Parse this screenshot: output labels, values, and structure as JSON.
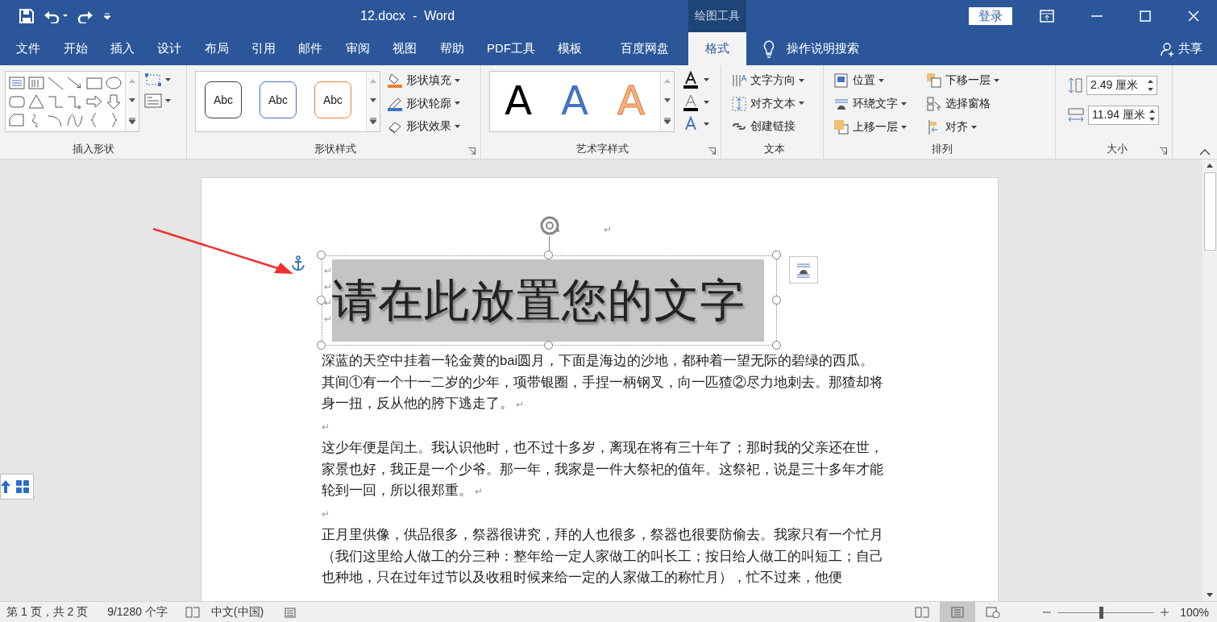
{
  "title_bar": {
    "title": "12.docx  -  Word",
    "contextual_label": "绘图工具",
    "login": "登录"
  },
  "tabs": [
    {
      "label": "文件",
      "kind": "main",
      "selected": false
    },
    {
      "label": "开始",
      "kind": "main",
      "selected": false
    },
    {
      "label": "插入",
      "kind": "main",
      "selected": false
    },
    {
      "label": "设计",
      "kind": "main",
      "selected": false
    },
    {
      "label": "布局",
      "kind": "main",
      "selected": false
    },
    {
      "label": "引用",
      "kind": "main",
      "selected": false
    },
    {
      "label": "邮件",
      "kind": "main",
      "selected": false
    },
    {
      "label": "审阅",
      "kind": "main",
      "selected": false
    },
    {
      "label": "视图",
      "kind": "main",
      "selected": false
    },
    {
      "label": "帮助",
      "kind": "main",
      "selected": false
    },
    {
      "label": "PDF工具",
      "kind": "main",
      "selected": false
    },
    {
      "label": "模板",
      "kind": "main",
      "selected": false
    },
    {
      "label": "百度网盘",
      "kind": "addin",
      "selected": false
    },
    {
      "label": "格式",
      "kind": "contextual",
      "selected": true
    }
  ],
  "tell_me": "操作说明搜索",
  "share": "共享",
  "ribbon": {
    "insert_shapes": {
      "label": "插入形状"
    },
    "shape_styles": {
      "label": "形状样式",
      "presets": [
        {
          "text": "Abc",
          "color": "#404040"
        },
        {
          "text": "Abc",
          "color": "#4472c4"
        },
        {
          "text": "Abc",
          "color": "#ed7d31"
        }
      ],
      "commands": [
        "形状填充",
        "形状轮廓",
        "形状效果"
      ]
    },
    "wordart_styles": {
      "label": "艺术字样式",
      "presets": [
        {
          "text": "A",
          "color": "#000000"
        },
        {
          "text": "A",
          "color": "#4472c4"
        },
        {
          "text": "A",
          "color": "#f4b183"
        }
      ]
    },
    "text": {
      "label": "文本",
      "commands": [
        "文字方向",
        "对齐文本",
        "创建链接"
      ]
    },
    "arrange": {
      "label": "排列",
      "commands": [
        "位置",
        "下移一层",
        "环绕文字",
        "选择窗格",
        "上移一层",
        "对齐"
      ]
    },
    "size": {
      "label": "大小",
      "height": "2.49 厘米",
      "width": "11.94 厘米"
    }
  },
  "document": {
    "top_mark": "↵",
    "textbox": {
      "text": "请在此放置您的文字",
      "marks": [
        "↵",
        "↵",
        "↵",
        "↵"
      ]
    },
    "paragraphs": [
      {
        "text": "深蓝的天空中挂着一轮金黄的bai圆月，下面是海边的沙地，都种着一望无际的碧绿的西瓜。其间①有一个十一二岁的少年，项带银圈，手捏一柄钢叉，向一匹猹②尽力地刺去。那猹却将身一扭，反从他的胯下逃走了。",
        "mark": "↵"
      },
      {
        "mark": "↵"
      },
      {
        "text": "这少年便是闰土。我认识他时，也不过十多岁，离现在将有三十年了；那时我的父亲还在世，家景也好，我正是一个少爷。那一年，我家是一件大祭祀的值年。这祭祀，说是三十多年才能轮到一回，所以很郑重。",
        "mark": "↵"
      },
      {
        "mark": "↵"
      },
      {
        "text": "正月里供像，供品很多，祭器很讲究，拜的人也很多，祭器也很要防偷去。我家只有一个忙月（我们这里给人做工的分三种：整年给一定人家做工的叫长工；按日给人做工的叫短工；自己也种地，只在过年过节以及收租时候来给一定的人家做工的称忙月），忙不过来，他便"
      }
    ]
  },
  "status_bar": {
    "page": "第 1 页，共 2 页",
    "words": "9/1280 个字",
    "language": "中文(中国)",
    "views": [
      {
        "selected": false
      },
      {
        "selected": true
      },
      {
        "selected": false
      }
    ],
    "zoom": {
      "level": 0.45,
      "text": "100%"
    }
  }
}
